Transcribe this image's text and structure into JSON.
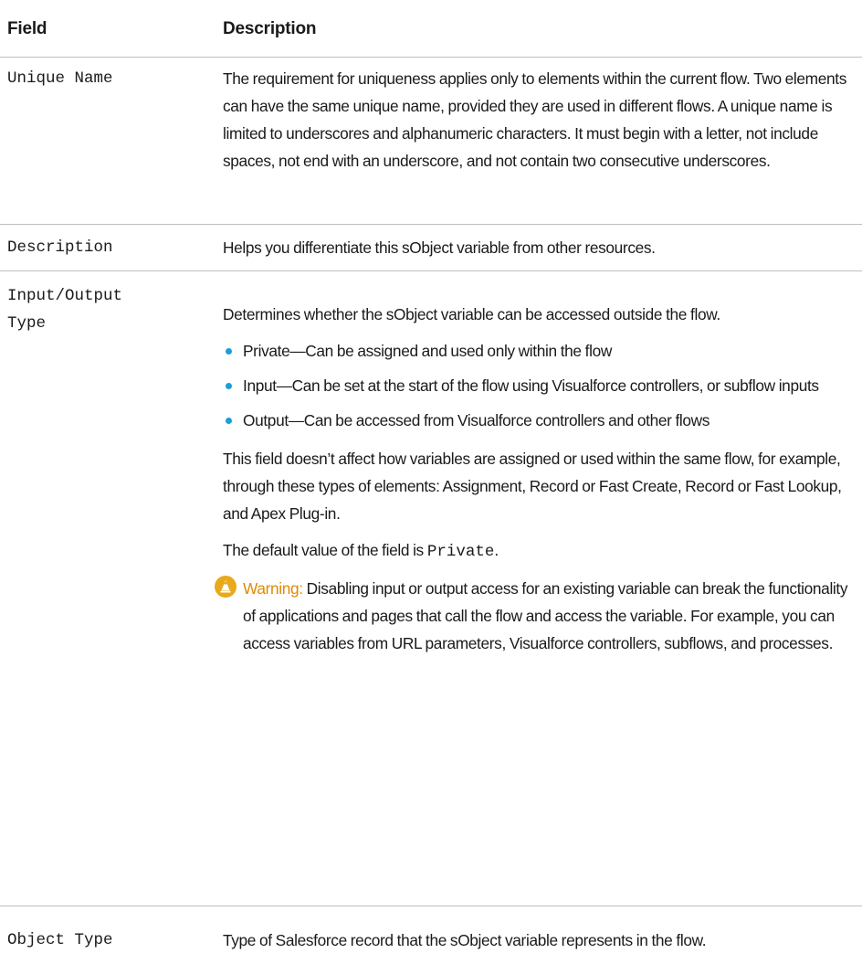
{
  "header": {
    "field": "Field",
    "description": "Description"
  },
  "rows": [
    {
      "field": "Unique Name",
      "description": "The requirement for uniqueness applies only to elements within the current flow. Two elements can have the same unique name, provided they are used in different flows. A unique name is limited to underscores and alphanumeric characters. It must begin with a letter, not include spaces, not end with an underscore, and not contain two consecutive underscores."
    },
    {
      "field": "Description",
      "description": "Helps you differentiate this sObject variable from other resources."
    },
    {
      "field": "Input/Output\nType",
      "intro": "Determines whether the sObject variable can be accessed outside the flow.",
      "bullets": [
        "Private—Can be assigned and used only within the flow",
        "Input—Can be set at the start of the flow using Visualforce controllers, or subflow inputs",
        "Output—Can be accessed from Visualforce controllers and other flows"
      ],
      "note": "This field doesn’t affect how variables are assigned or used within the same flow, for example, through these types of elements: Assignment, Record or Fast Create, Record or Fast Lookup, and Apex Plug-in.",
      "default_prefix": "The default value of the field is",
      "default_value": "Private",
      "default_suffix": ".",
      "warning_label": "Warning:",
      "warning_text": "Disabling input or output access for an existing variable can break the functionality of applications and pages that call the flow and access the variable. For example, you can access variables from URL parameters, Visualforce controllers, subflows, and processes."
    },
    {
      "field": "Object Type",
      "description": "Type of Salesforce record that the sObject variable represents in the flow."
    }
  ],
  "colors": {
    "accent_blue": "#1a9fd9",
    "warning_orange": "#e08a00",
    "warning_icon": "#e8a91c",
    "rule": "#bfbfbf"
  },
  "icons": {
    "warning": "warning-icon"
  }
}
